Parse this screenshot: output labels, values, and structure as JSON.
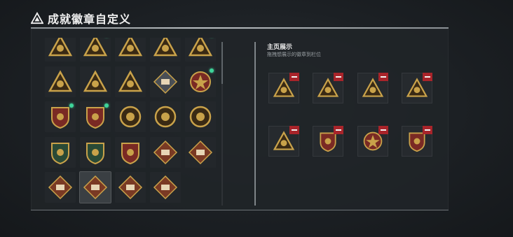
{
  "header": {
    "title": "成就徽章自定义"
  },
  "showcase": {
    "title": "主页展示",
    "subtitle": "拖拽想展示的徽章到栏位"
  },
  "colors": {
    "accent_new": "#3ed49a",
    "remove_red": "#a8242a",
    "gold": "#c9a24a"
  },
  "badge_grid": {
    "rows": [
      [
        {
          "icon": "badge-triangle-fist-icon",
          "is_new": false
        },
        {
          "icon": "badge-triangle-56-icon",
          "is_new": true
        },
        {
          "icon": "badge-triangle-lantern-icon",
          "is_new": false
        },
        {
          "icon": "badge-triangle-robot-icon",
          "is_new": false
        },
        {
          "icon": "badge-triangle-castle-icon",
          "is_new": true
        },
        {
          "icon": "badge-triangle-helmet-icon",
          "is_new": true
        }
      ],
      [
        {
          "icon": "badge-triangle-rank1-icon",
          "is_new": false
        },
        {
          "icon": "badge-triangle-eagle-icon",
          "is_new": false
        },
        {
          "icon": "badge-triangle-wings-icon",
          "is_new": false
        },
        {
          "icon": "badge-diamond-crate-icon",
          "is_new": false
        },
        {
          "icon": "badge-medal-star-icon",
          "is_new": true
        },
        {
          "icon": "badge-shield-hand-icon",
          "is_new": false
        }
      ],
      [
        {
          "icon": "badge-shield-emblem-icon",
          "is_new": true
        },
        {
          "icon": "badge-shield-eagle-icon",
          "is_new": true
        },
        {
          "icon": "badge-circle-skull-icon",
          "is_new": false
        },
        {
          "icon": "badge-circle-target-icon",
          "is_new": false
        },
        {
          "icon": "badge-circle-wreath-icon",
          "is_new": false
        },
        {
          "icon": "badge-shield-stars-icon",
          "is_new": false
        }
      ],
      [
        {
          "icon": "badge-shield-rifle-icon",
          "is_new": false
        },
        {
          "icon": "badge-shield-knife-icon",
          "is_new": false
        },
        {
          "icon": "badge-shield-crossed-icon",
          "is_new": false
        },
        {
          "icon": "badge-diamond-bear-icon",
          "is_new": false
        },
        {
          "icon": "badge-diamond-heli-icon",
          "is_new": false
        },
        {
          "icon": "badge-hex-hand-icon",
          "is_new": false
        }
      ],
      [
        {
          "icon": "badge-diamond-dog-icon",
          "is_new": false
        },
        {
          "icon": "badge-diamond-wolf-icon",
          "is_new": false,
          "selected": true
        },
        {
          "icon": "badge-diamond-runner-icon",
          "is_new": false
        },
        {
          "icon": "badge-diamond-vest-icon",
          "is_new": false
        }
      ]
    ]
  },
  "showcase_slots": [
    {
      "icon": "badge-triangle-skull-icon"
    },
    {
      "icon": "badge-triangle-helmet-icon"
    },
    {
      "icon": "badge-triangle-castle-icon"
    },
    {
      "icon": "badge-triangle-56-icon"
    },
    {
      "icon": "badge-triangle-helmet2-icon"
    },
    {
      "icon": "badge-shield-eagle-icon"
    },
    {
      "icon": "badge-medal-star-icon"
    },
    {
      "icon": "badge-shield-emblem-icon"
    }
  ]
}
